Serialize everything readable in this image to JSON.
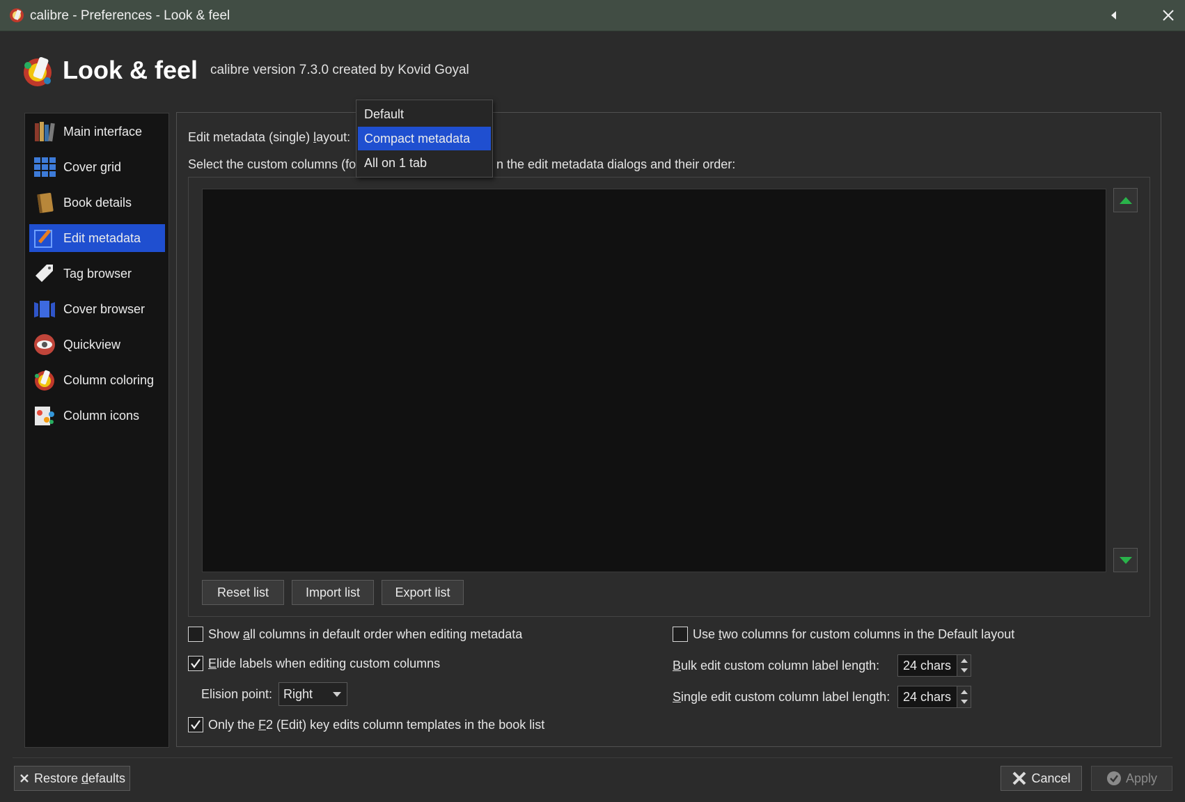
{
  "window": {
    "title": "calibre - Preferences - Look & feel",
    "back_icon": "back-triangle-icon",
    "close_icon": "close-icon"
  },
  "header": {
    "title": "Look & feel",
    "version": "calibre version 7.3.0 created by Kovid Goyal"
  },
  "sidebar": {
    "items": [
      {
        "label": "Main interface",
        "icon": "books-icon"
      },
      {
        "label": "Cover grid",
        "icon": "grid-icon"
      },
      {
        "label": "Book details",
        "icon": "book-icon"
      },
      {
        "label": "Edit metadata",
        "icon": "pencil-icon",
        "active": true
      },
      {
        "label": "Tag browser",
        "icon": "tag-icon"
      },
      {
        "label": "Cover browser",
        "icon": "cover-browser-icon"
      },
      {
        "label": "Quickview",
        "icon": "eye-icon"
      },
      {
        "label": "Column coloring",
        "icon": "palette-icon"
      },
      {
        "label": "Column icons",
        "icon": "column-icons-icon"
      }
    ]
  },
  "main": {
    "layout_label_prefix": "Edit metadata (single) ",
    "layout_label_u": "l",
    "layout_label_suffix": "ayout:",
    "custom_columns_label_left": "Select the custom columns (fo",
    "custom_columns_label_right": "n the edit metadata dialogs and their order:",
    "buttons": {
      "reset": "Reset list",
      "import": "Import list",
      "export": "Export list"
    },
    "options": {
      "show_all_pre": "Show ",
      "show_all_u": "a",
      "show_all_post": "ll columns in default order when editing metadata",
      "show_all_checked": false,
      "elide_u": "E",
      "elide_post": "lide labels when editing custom columns",
      "elide_checked": true,
      "elision_label": "Elision point:",
      "elision_value": "Right",
      "f2_pre": "Only the ",
      "f2_u": "F",
      "f2_post": "2 (Edit) key edits column templates in the book list",
      "f2_checked": true,
      "two_cols_pre": "Use ",
      "two_cols_u": "t",
      "two_cols_post": "wo columns for custom columns in the Default layout",
      "two_cols_checked": false,
      "bulk_u": "B",
      "bulk_post": "ulk edit custom column label length:",
      "bulk_value": "24 chars",
      "single_u": "S",
      "single_post": "ingle edit custom column label length:",
      "single_value": "24 chars"
    }
  },
  "dropdown": {
    "options": [
      "Default",
      "Compact metadata",
      "All on 1 tab"
    ],
    "selected": "Compact metadata"
  },
  "footer": {
    "restore_pre": "Restore ",
    "restore_u": "d",
    "restore_post": "efaults",
    "cancel": "Cancel",
    "apply": "Apply"
  },
  "colors": {
    "titlebar": "#414d44",
    "accent": "#1f4fd0",
    "background": "#2b2b2b"
  }
}
